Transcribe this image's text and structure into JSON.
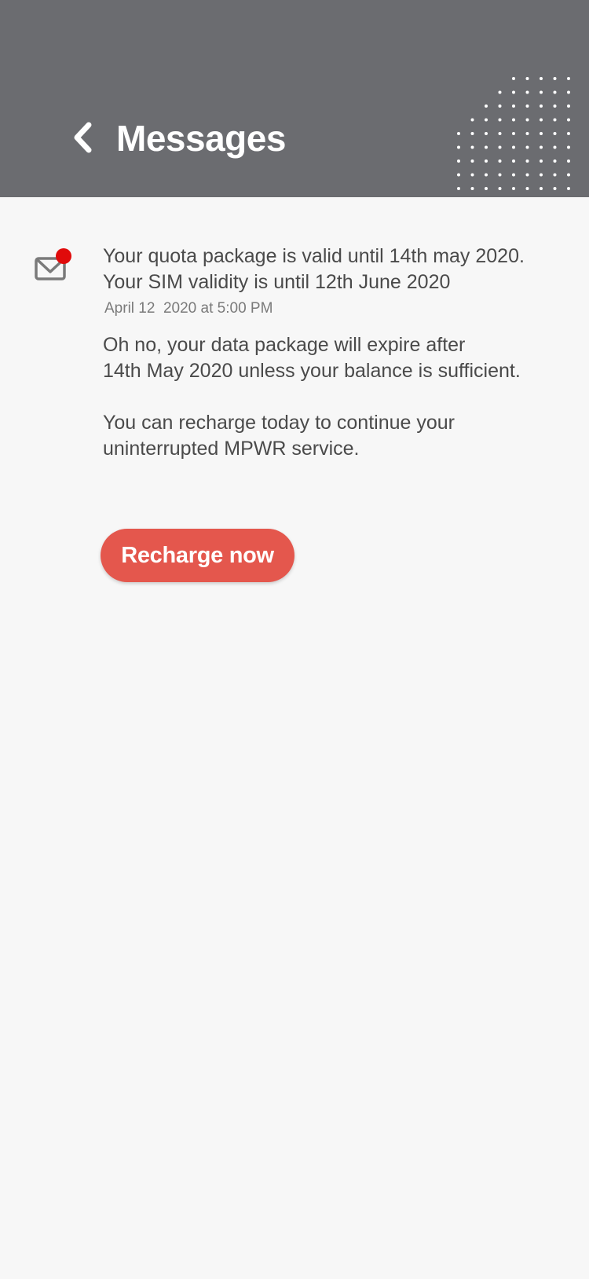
{
  "header": {
    "title": "Messages",
    "background_color": "#6b6c70",
    "back_icon": "chevron-left-icon"
  },
  "message": {
    "icon": "mail-icon",
    "unread": true,
    "unread_color": "#e00b0b",
    "subject_lines": [
      "Your quota package is valid until 14th may 2020.",
      "Your SIM validity is until 12th June 2020"
    ],
    "timestamp": "April 12  2020 at 5:00 PM",
    "body_paragraphs": [
      "Oh no, your data package will expire after\n14th May 2020 unless your balance is sufficient.",
      "You can recharge today to continue your\nuninterrupted MPWR service."
    ]
  },
  "actions": {
    "recharge_label": "Recharge now",
    "recharge_color": "#e4574d"
  }
}
